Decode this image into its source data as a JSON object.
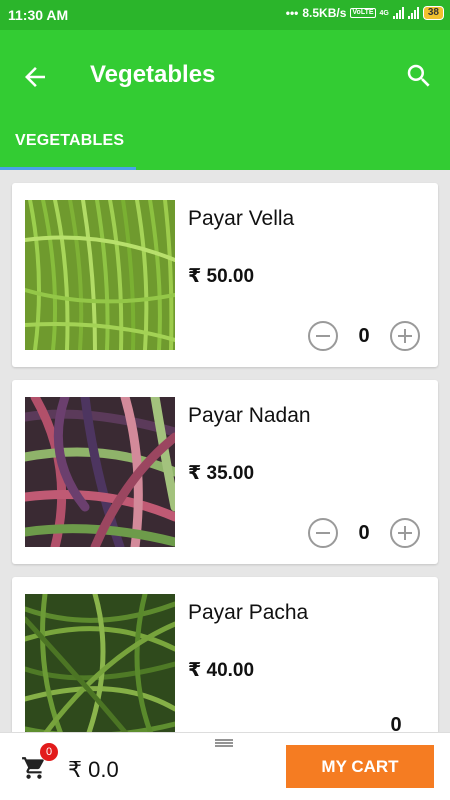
{
  "status_bar": {
    "time": "11:30 AM",
    "speed": "8.5KB/s",
    "volte": "VoLTE",
    "network": "4G",
    "battery": "38"
  },
  "app_bar": {
    "title": "Vegetables",
    "back_icon": "arrow-back-icon",
    "search_icon": "search-icon"
  },
  "tabs": [
    {
      "label": "VEGETABLES",
      "selected": true
    }
  ],
  "products": [
    {
      "name": "Payar Vella",
      "price": "₹ 50.00",
      "qty": "0"
    },
    {
      "name": "Payar Nadan",
      "price": "₹ 35.00",
      "qty": "0"
    },
    {
      "name": "Payar Pacha",
      "price": "₹ 40.00",
      "qty": "0"
    }
  ],
  "bottom_bar": {
    "cart_icon": "shopping-cart-icon",
    "cart_count": "0",
    "total": "₹ 0.0",
    "my_cart_label": "MY CART"
  },
  "colors": {
    "status_bar": "#2bb52b",
    "app_bar": "#33cc33",
    "tab_indicator": "#4aa3e8",
    "my_cart_button": "#f57c22",
    "badge": "#e21b1b"
  }
}
